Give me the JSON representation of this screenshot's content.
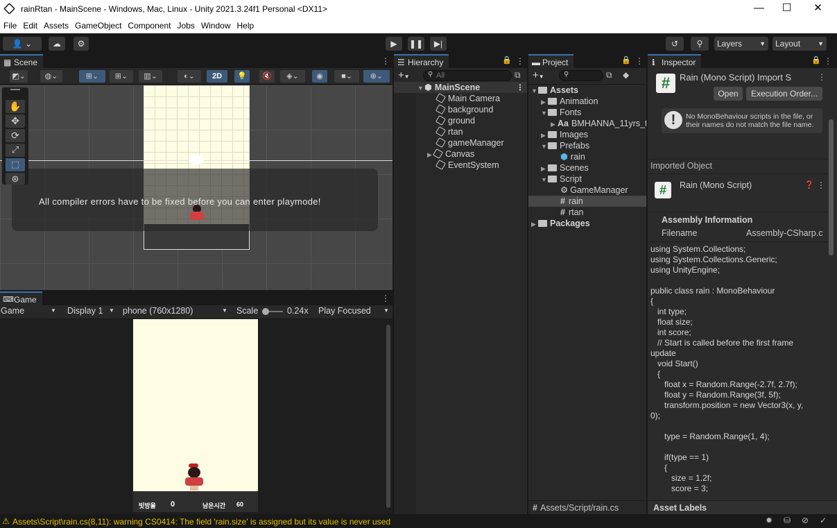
{
  "window": {
    "title": "rainRtan - MainScene - Windows, Mac, Linux - Unity 2021.3.24f1 Personal <DX11>",
    "minimize": "—",
    "maximize": "☐",
    "close": "✕"
  },
  "menu": [
    "File",
    "Edit",
    "Assets",
    "GameObject",
    "Component",
    "Jobs",
    "Window",
    "Help"
  ],
  "toolbar": {
    "layers": "Layers",
    "layout": "Layout"
  },
  "scene": {
    "tab": "Scene",
    "btn2d": "2D",
    "message": "All compiler errors have to be fixed before you can enter playmode!"
  },
  "game": {
    "tab": "Game",
    "mode": "Game",
    "display": "Display 1",
    "resolution": "phone (760x1280)",
    "scale_label": "Scale",
    "scale_value": "0.24x",
    "play_focused": "Play Focused",
    "hud_score_label": "빗방울",
    "hud_score": "0",
    "hud_time_label": "남은시간",
    "hud_time": "60"
  },
  "hierarchy": {
    "tab": "Hierarchy",
    "search_placeholder": "All",
    "root": "MainScene",
    "items": [
      "Main Camera",
      "background",
      "ground",
      "rtan",
      "gameManager",
      "Canvas",
      "EventSystem"
    ]
  },
  "project": {
    "tab": "Project",
    "assets": "Assets",
    "animation": "Animation",
    "fonts": "Fonts",
    "font_file": "BMHANNA_11yrs_tt",
    "font_prefix": "Aa",
    "images": "Images",
    "prefabs": "Prefabs",
    "prefab_rain": "rain",
    "scenes": "Scenes",
    "script": "Script",
    "scripts": [
      "GameManager",
      "rain",
      "rtan"
    ],
    "packages": "Packages",
    "footer_path": "Assets/Script/rain.cs"
  },
  "inspector": {
    "tab": "Inspector",
    "title": "Rain (Mono Script) Import S",
    "open": "Open",
    "exec_order": "Execution Order...",
    "warning": "No MonoBehaviour scripts in the file, or their names do not match the file name.",
    "imported_object": "Imported Object",
    "script_name": "Rain (Mono Script)",
    "assembly_info": "Assembly Information",
    "filename_label": "Filename",
    "filename_value": "Assembly-CSharp.c",
    "asset_labels": "Asset Labels",
    "code": "using System.Collections;\nusing System.Collections.Generic;\nusing UnityEngine;\n\npublic class rain : MonoBehaviour\n{\n   int type;\n   float size;\n   int score;\n   // Start is called before the first frame\nupdate\n   void Start()\n   {\n      float x = Random.Range(-2.7f, 2.7f);\n      float y = Random.Range(3f, 5f);\n      transform.position = new Vector3(x, y,\n0);\n\n      type = Random.Range(1, 4);\n\n      if(type == 1)\n      {\n         size = 1.2f;\n         score = 3;"
  },
  "status": {
    "message": "Assets\\Script\\rain.cs(8,11): warning CS0414: The field 'rain.size' is assigned but its value is never used"
  },
  "colors": {
    "accent": "#3a72b0",
    "warning": "#e2c200",
    "game_bg": "#fefde4"
  }
}
